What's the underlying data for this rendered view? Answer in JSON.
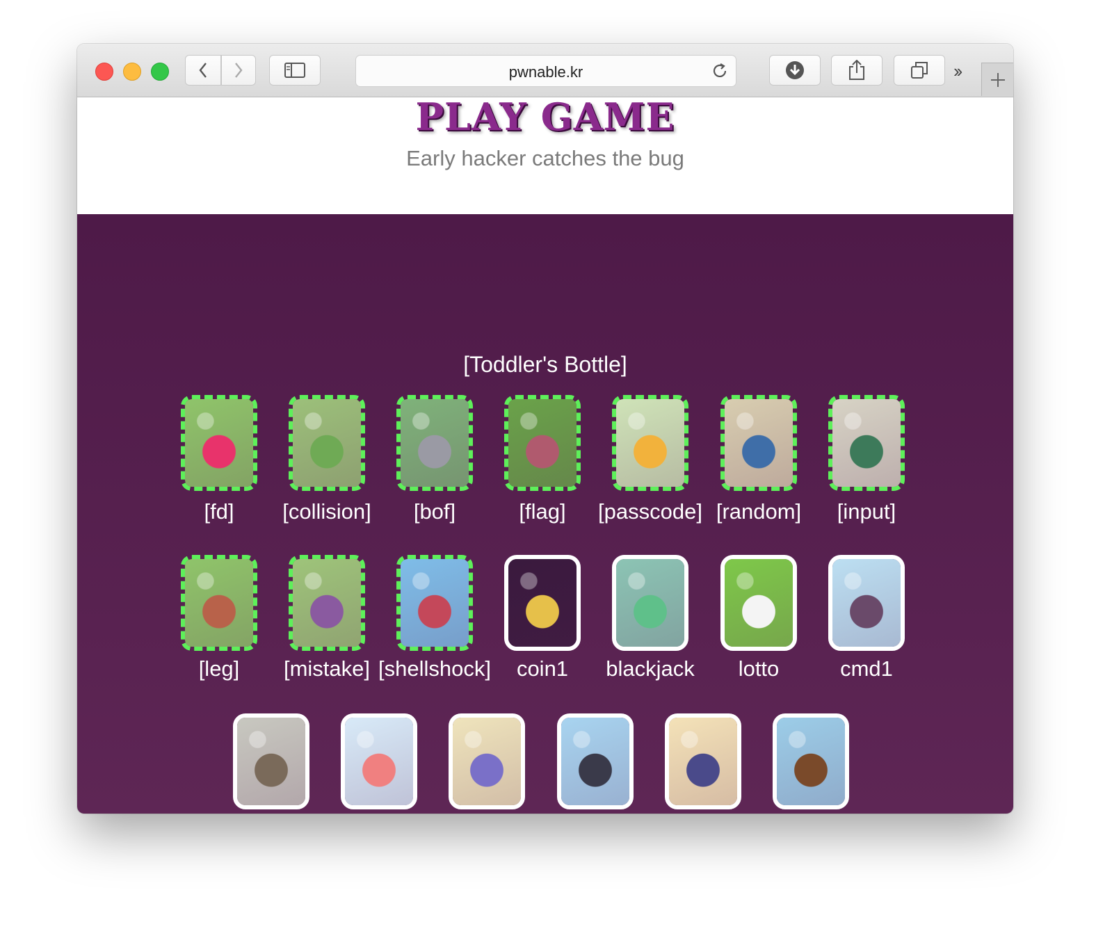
{
  "browser": {
    "url": "pwnable.kr"
  },
  "header": {
    "logo_text": "PLAY GAME",
    "tagline": "Early hacker catches the bug"
  },
  "section": {
    "title": "[Toddler's Bottle]"
  },
  "challenges": [
    {
      "label": "[fd]",
      "style": "dashed",
      "icon": "pink-slime-icon",
      "colors": [
        "#8fc46a",
        "#e8336b"
      ]
    },
    {
      "label": "[collision]",
      "style": "dashed",
      "icon": "green-caterpillar-icon",
      "colors": [
        "#9cc07a",
        "#6faa55"
      ]
    },
    {
      "label": "[bof]",
      "style": "dashed",
      "icon": "raccoon-icon",
      "colors": [
        "#7fb27a",
        "#9a9aa4"
      ]
    },
    {
      "label": "[flag]",
      "style": "dashed",
      "icon": "cocoon-icon",
      "colors": [
        "#6aa24a",
        "#b05a6e"
      ]
    },
    {
      "label": "[passcode]",
      "style": "dashed",
      "icon": "yellow-bird-icon",
      "colors": [
        "#cfe3b8",
        "#f2b23c"
      ]
    },
    {
      "label": "[random]",
      "style": "dashed",
      "icon": "blue-wolf-icon",
      "colors": [
        "#d8cdb0",
        "#3f6ea8"
      ]
    },
    {
      "label": "[input]",
      "style": "dashed",
      "icon": "boxing-beetle-icon",
      "colors": [
        "#d7d3c5",
        "#3d7a5a"
      ]
    },
    {
      "label": "[leg]",
      "style": "dashed",
      "icon": "bear-icon",
      "colors": [
        "#8fc46a",
        "#b8624a"
      ]
    },
    {
      "label": "[mistake]",
      "style": "dashed",
      "icon": "monkey-icon",
      "colors": [
        "#9ec47a",
        "#8a5aa0"
      ]
    },
    {
      "label": "[shellshock]",
      "style": "dashed",
      "icon": "venus-flytrap-icon",
      "colors": [
        "#7fbde8",
        "#c4485a"
      ]
    },
    {
      "label": "coin1",
      "style": "solid",
      "icon": "pumpkin-ghost-icon",
      "colors": [
        "#3a1a3e",
        "#e6c04a"
      ]
    },
    {
      "label": "blackjack",
      "style": "solid",
      "icon": "green-lizard-icon",
      "colors": [
        "#8cc4b4",
        "#5fc08a"
      ]
    },
    {
      "label": "lotto",
      "style": "solid",
      "icon": "white-rabbit-icon",
      "colors": [
        "#7ec84a",
        "#f4f4f4"
      ]
    },
    {
      "label": "cmd1",
      "style": "solid",
      "icon": "girl-umbrella-icon",
      "colors": [
        "#bcdff2",
        "#6a4a6a"
      ]
    },
    {
      "label": "",
      "style": "solid",
      "icon": "hermit-crab-icon",
      "colors": [
        "#c8c8c0",
        "#7a6a5a"
      ]
    },
    {
      "label": "",
      "style": "solid",
      "icon": "cloud-slime-icon",
      "colors": [
        "#d8eaf8",
        "#f08080"
      ]
    },
    {
      "label": "",
      "style": "solid",
      "icon": "sleeping-creatures-icon",
      "colors": [
        "#efe4bc",
        "#7a70c8"
      ]
    },
    {
      "label": "",
      "style": "solid",
      "icon": "bat-cat-icon",
      "colors": [
        "#a8d4f0",
        "#3a3a4a"
      ]
    },
    {
      "label": "",
      "style": "solid",
      "icon": "penguin-beach-icon",
      "colors": [
        "#f4e2b8",
        "#4a4a8a"
      ]
    },
    {
      "label": "",
      "style": "solid",
      "icon": "rhino-beetle-icon",
      "colors": [
        "#9ccde8",
        "#7a4a2a"
      ]
    }
  ]
}
